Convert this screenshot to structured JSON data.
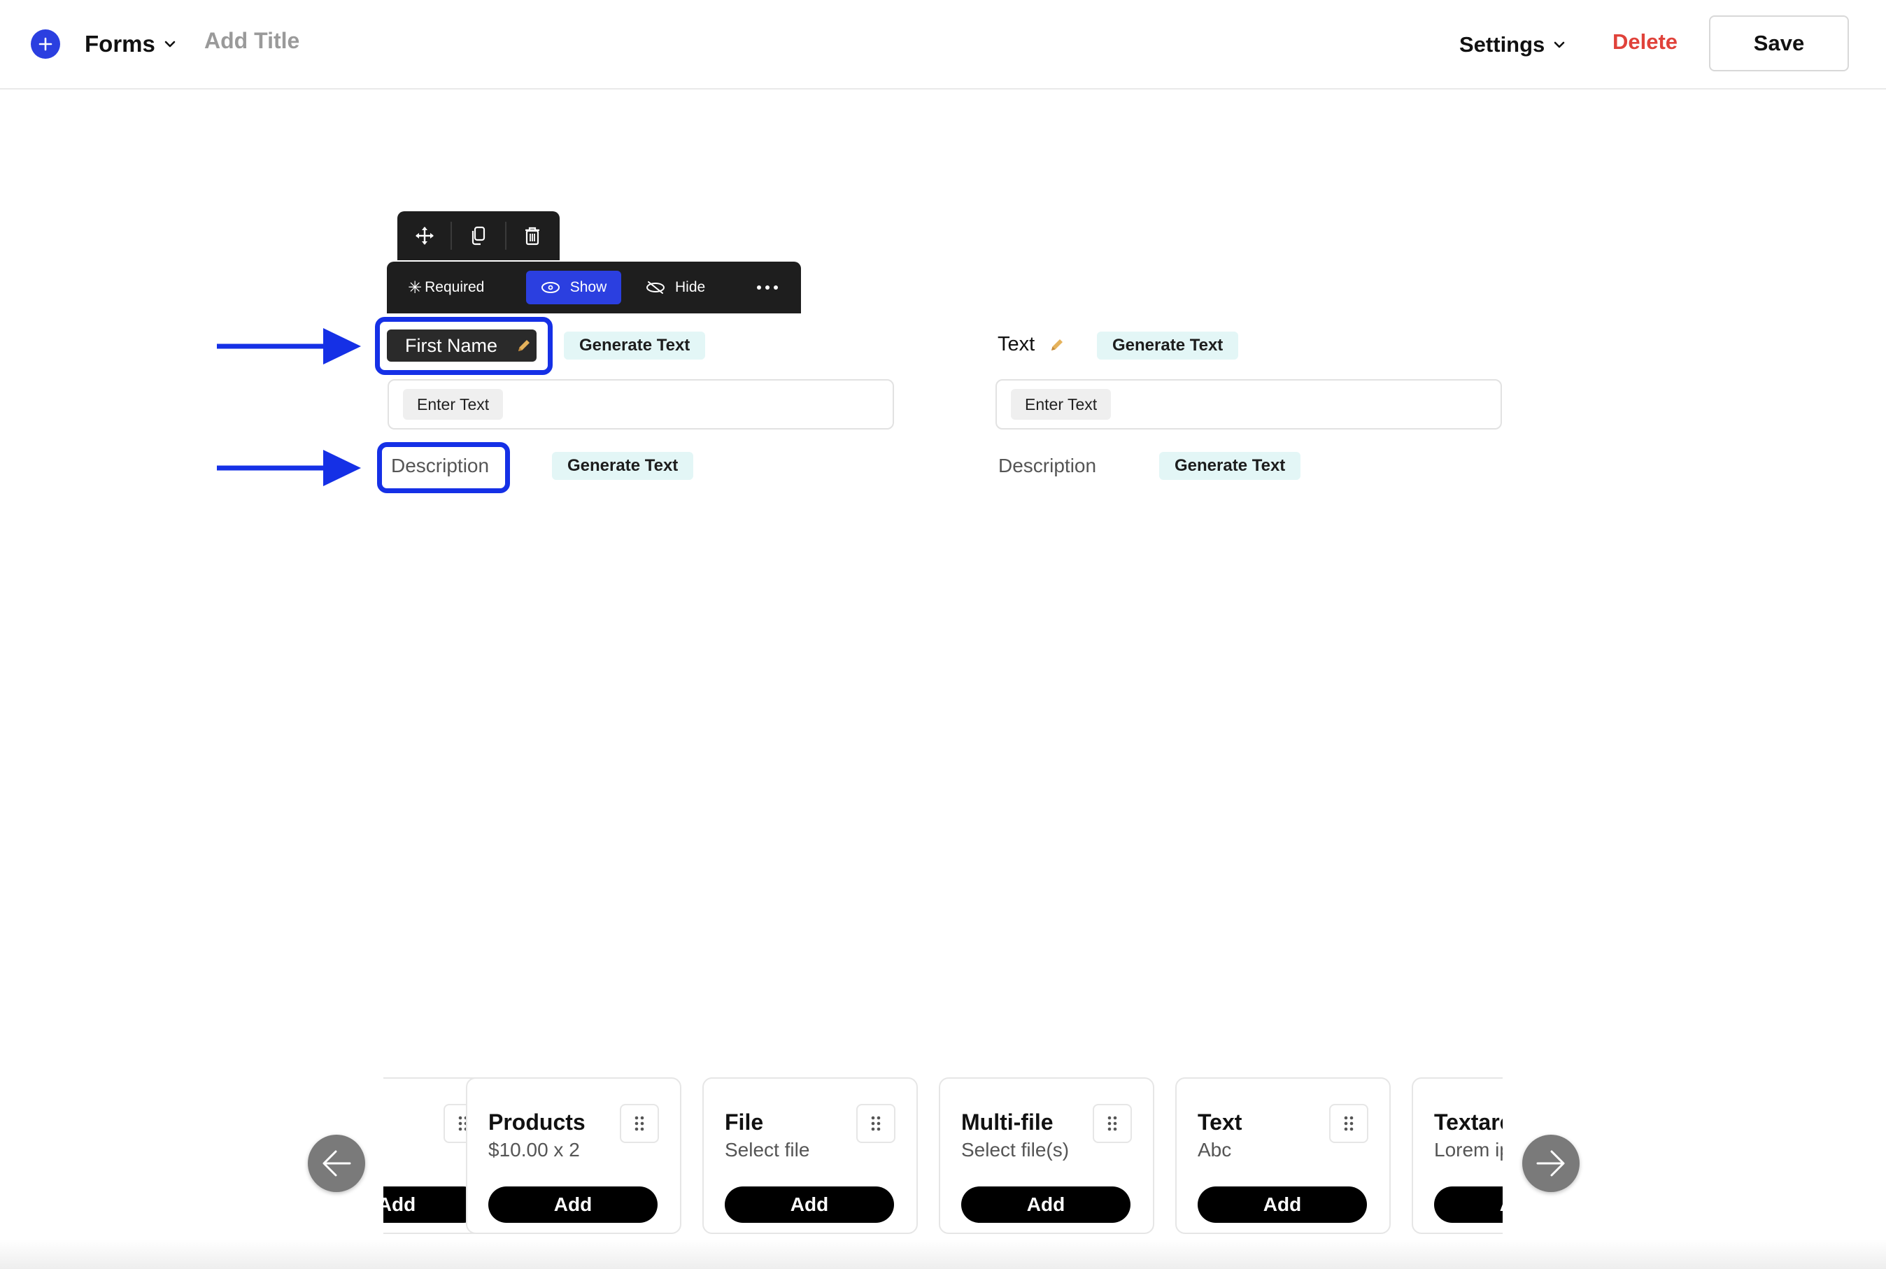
{
  "header": {
    "forms_label": "Forms",
    "title_placeholder": "Add Title",
    "settings_label": "Settings",
    "delete_label": "Delete",
    "save_label": "Save"
  },
  "toolbar": {
    "required_label": "Required",
    "show_label": "Show",
    "hide_label": "Hide"
  },
  "fields": [
    {
      "label": "First Name",
      "generate_label": "Generate Text",
      "input_placeholder": "Enter Text",
      "description": "Description",
      "description_generate_label": "Generate Text"
    },
    {
      "label": "Text",
      "generate_label": "Generate Text",
      "input_placeholder": "Enter Text",
      "description": "Description",
      "description_generate_label": "Generate Text"
    }
  ],
  "carousel": {
    "cards": [
      {
        "title": "",
        "subtitle": "",
        "add_label": "Add"
      },
      {
        "title": "Products",
        "subtitle": "$10.00 x 2",
        "add_label": "Add"
      },
      {
        "title": "File",
        "subtitle": "Select file",
        "add_label": "Add"
      },
      {
        "title": "Multi-file",
        "subtitle": "Select file(s)",
        "add_label": "Add"
      },
      {
        "title": "Text",
        "subtitle": "Abc",
        "add_label": "Add"
      },
      {
        "title": "Textarea",
        "subtitle": "Lorem ipsum",
        "add_label": "Add"
      }
    ]
  },
  "colors": {
    "accent_blue": "#2b3fe0",
    "highlight_blue": "#1530e6",
    "delete_red": "#e0423a",
    "generate_bg": "#e3f6f6",
    "toolbar_dark": "#1e1e1e"
  }
}
